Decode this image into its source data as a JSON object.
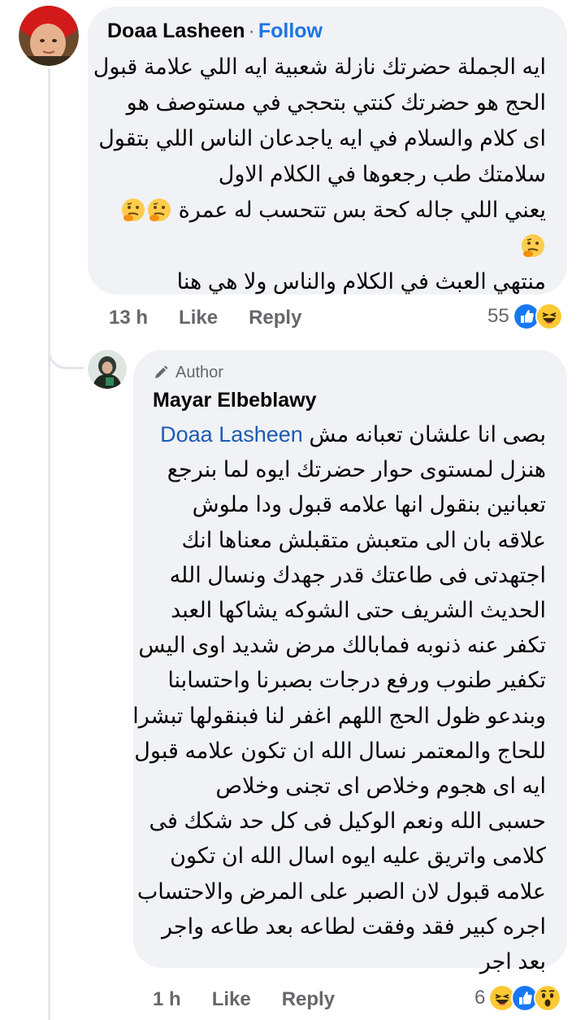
{
  "comment": {
    "author": "Doaa Lasheen",
    "separator": "·",
    "follow_label": "Follow",
    "lines": [
      "ايه الجملة حضرتك نازلة شعبية ايه اللي علامة قبول",
      "الحج هو حضرتك كنتي بتحجي في مستوصف هو",
      "اى كلام والسلام في ايه ياجدعان الناس اللي بتقول",
      "سلامتك طب رجعوها في الكلام الاول",
      "يعني اللي جاله كحة بس تتحسب له عمرة",
      "",
      "منتهي العبث في الكلام والناس ولا هي هنا"
    ],
    "time": "13 h",
    "like_label": "Like",
    "reply_label": "Reply",
    "reaction_count": "55",
    "reaction_icons": [
      "like-icon",
      "haha-icon"
    ]
  },
  "reply": {
    "badge_label": "Author",
    "author": "Mayar Elbeblawy",
    "mention": "Doaa Lasheen",
    "first_line_rest": "بصى انا علشان تعبانه مش",
    "lines": [
      "هنزل لمستوى حوار حضرتك ايوه لما بنرجع",
      "تعبانين  بنقول انها علامه قبول ودا ملوش",
      "علاقه بان الى متعبش متقبلش معناها انك",
      "اجتهدتى فى طاعتك قدر جهدك ونسال الله",
      "الحديث الشريف حتى الشوكه يشاكها العبد",
      "تكفر  عنه ذنوبه فمابالك مرض شديد اوى اليس",
      "تكفير طنوب ورفع درجات بصبرنا واحتسابنا",
      "وبندعو ظول الحج اللهم اغفر لنا فبنقولها تبشرا",
      "للحاج والمعتمر نسال الله ان تكون علامه قبول",
      "ايه اى هجوم وخلاص اى تجنى وخلاص",
      "حسبى الله ونعم الوكيل فى كل حد شكك فى",
      "كلامى واتريق عليه ايوه اسال  الله ان تكون",
      "علامه قبول لان الصبر على المرض والاحتساب",
      "اجره كبير فقد وفقت لطاعه بعد طاعه واجر",
      "بعد اجر"
    ],
    "time": "1 h",
    "like_label": "Like",
    "reply_label": "Reply",
    "reaction_count": "6",
    "reaction_icons": [
      "haha-icon",
      "like-icon",
      "wow-icon"
    ]
  },
  "colors": {
    "bubble": "#f0f2f5",
    "follow": "#1b74e4",
    "mention": "#1d5bb3",
    "meta": "#65676b"
  }
}
